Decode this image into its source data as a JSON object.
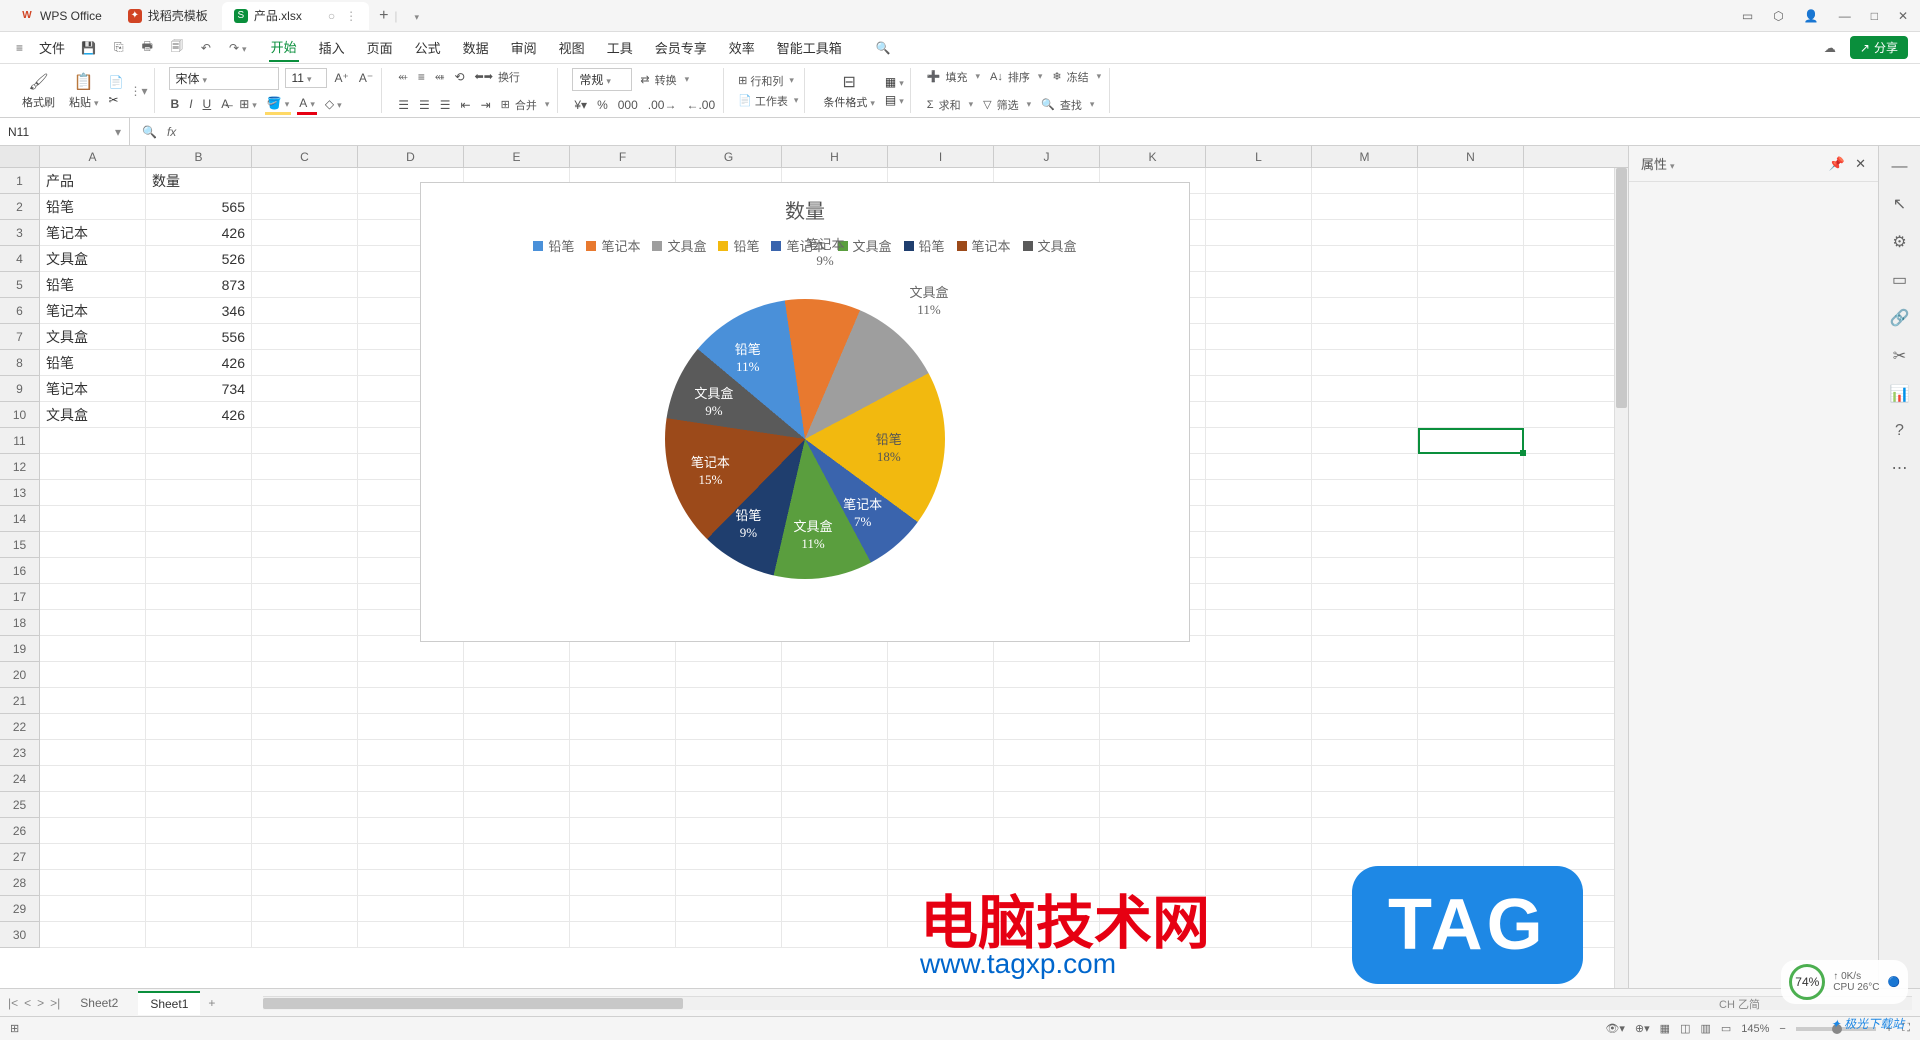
{
  "titlebar": {
    "tab1": "WPS Office",
    "tab2": "找稻壳模板",
    "tab3": "产品.xlsx",
    "tab3_badge": "S"
  },
  "file_menu": "文件",
  "menus": [
    "开始",
    "插入",
    "页面",
    "公式",
    "数据",
    "审阅",
    "视图",
    "工具",
    "会员专享",
    "效率",
    "智能工具箱"
  ],
  "share": "分享",
  "ribbon": {
    "format_brush": "格式刷",
    "paste": "粘贴",
    "font": "宋体",
    "size": "11",
    "wrap": "换行",
    "general": "常规",
    "convert": "转换",
    "rowcol": "行和列",
    "worksheet": "工作表",
    "cond_format": "条件格式",
    "merge": "合并",
    "fill": "填充",
    "sort": "排序",
    "freeze": "冻结",
    "sum": "求和",
    "filter": "筛选",
    "find": "查找"
  },
  "name_box": "N11",
  "columns": [
    "A",
    "B",
    "C",
    "D",
    "E",
    "F",
    "G",
    "H",
    "I",
    "J",
    "K",
    "L",
    "M",
    "N"
  ],
  "data_rows": [
    {
      "a": "产品",
      "b": "数量"
    },
    {
      "a": "铅笔",
      "b": "565"
    },
    {
      "a": "笔记本",
      "b": "426"
    },
    {
      "a": "文具盒",
      "b": "526"
    },
    {
      "a": "铅笔",
      "b": "873"
    },
    {
      "a": "笔记本",
      "b": "346"
    },
    {
      "a": "文具盒",
      "b": "556"
    },
    {
      "a": "铅笔",
      "b": "426"
    },
    {
      "a": "笔记本",
      "b": "734"
    },
    {
      "a": "文具盒",
      "b": "426"
    }
  ],
  "chart_data": {
    "type": "pie",
    "title": "数量",
    "series": [
      {
        "name": "铅笔",
        "value": 565,
        "percent": 11,
        "color": "#4a90d9"
      },
      {
        "name": "笔记本",
        "value": 426,
        "percent": 9,
        "color": "#e8792f"
      },
      {
        "name": "文具盒",
        "value": 526,
        "percent": 11,
        "color": "#9e9e9e"
      },
      {
        "name": "铅笔",
        "value": 873,
        "percent": 18,
        "color": "#f2b90f"
      },
      {
        "name": "笔记本",
        "value": 346,
        "percent": 7,
        "color": "#3a64ad"
      },
      {
        "name": "文具盒",
        "value": 556,
        "percent": 11,
        "color": "#5a9e3e"
      },
      {
        "name": "铅笔",
        "value": 426,
        "percent": 9,
        "color": "#1f3e6e"
      },
      {
        "name": "笔记本",
        "value": 734,
        "percent": 15,
        "color": "#9c4a1a"
      },
      {
        "name": "文具盒",
        "value": 426,
        "percent": 9,
        "color": "#5a5a5a"
      }
    ]
  },
  "side_panel_title": "属性",
  "sheets": {
    "s1": "Sheet2",
    "s2": "Sheet1"
  },
  "zoom": "145%",
  "watermarks": {
    "cn": "电脑技术网",
    "url": "www.tagxp.com",
    "tag": "TAG",
    "jiguang": "极光下载站"
  },
  "sys": {
    "pct": "74%",
    "net": "0K/s",
    "cpu": "CPU 26°C",
    "ime": "CH 乙简"
  }
}
